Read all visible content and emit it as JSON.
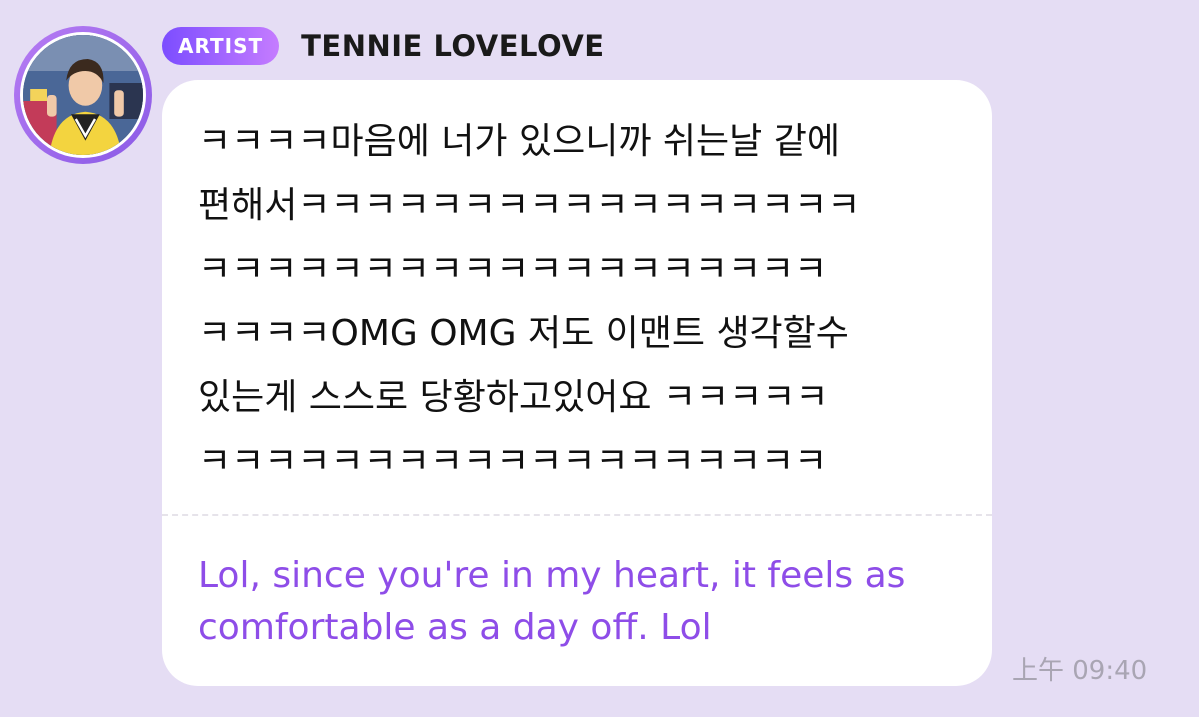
{
  "sender": {
    "badge": "ARTIST",
    "name": "TENNIE LOVELOVE",
    "avatar_icon": "artist-avatar-photo"
  },
  "message": {
    "original_text": "ㅋㅋㅋㅋ마음에 너가 있으니까 쉬는날 같에\n편해서ㅋㅋㅋㅋㅋㅋㅋㅋㅋㅋㅋㅋㅋㅋㅋㅋㅋ\nㅋㅋㅋㅋㅋㅋㅋㅋㅋㅋㅋㅋㅋㅋㅋㅋㅋㅋㅋ\nㅋㅋㅋㅋOMG OMG 저도 이맨트 생각할수\n있는게 스스로 당황하고있어요 ㅋㅋㅋㅋㅋ\nㅋㅋㅋㅋㅋㅋㅋㅋㅋㅋㅋㅋㅋㅋㅋㅋㅋㅋㅋ",
    "translation": "Lol, since you're in my heart, it feels as comfortable as a day off. Lol",
    "timestamp": "上午 09:40"
  },
  "colors": {
    "background": "#e5ddf4",
    "badge_gradient_start": "#7c4dff",
    "badge_gradient_end": "#c57cff",
    "translation_text": "#8e4de8",
    "timestamp_text": "#a9a5b3"
  }
}
